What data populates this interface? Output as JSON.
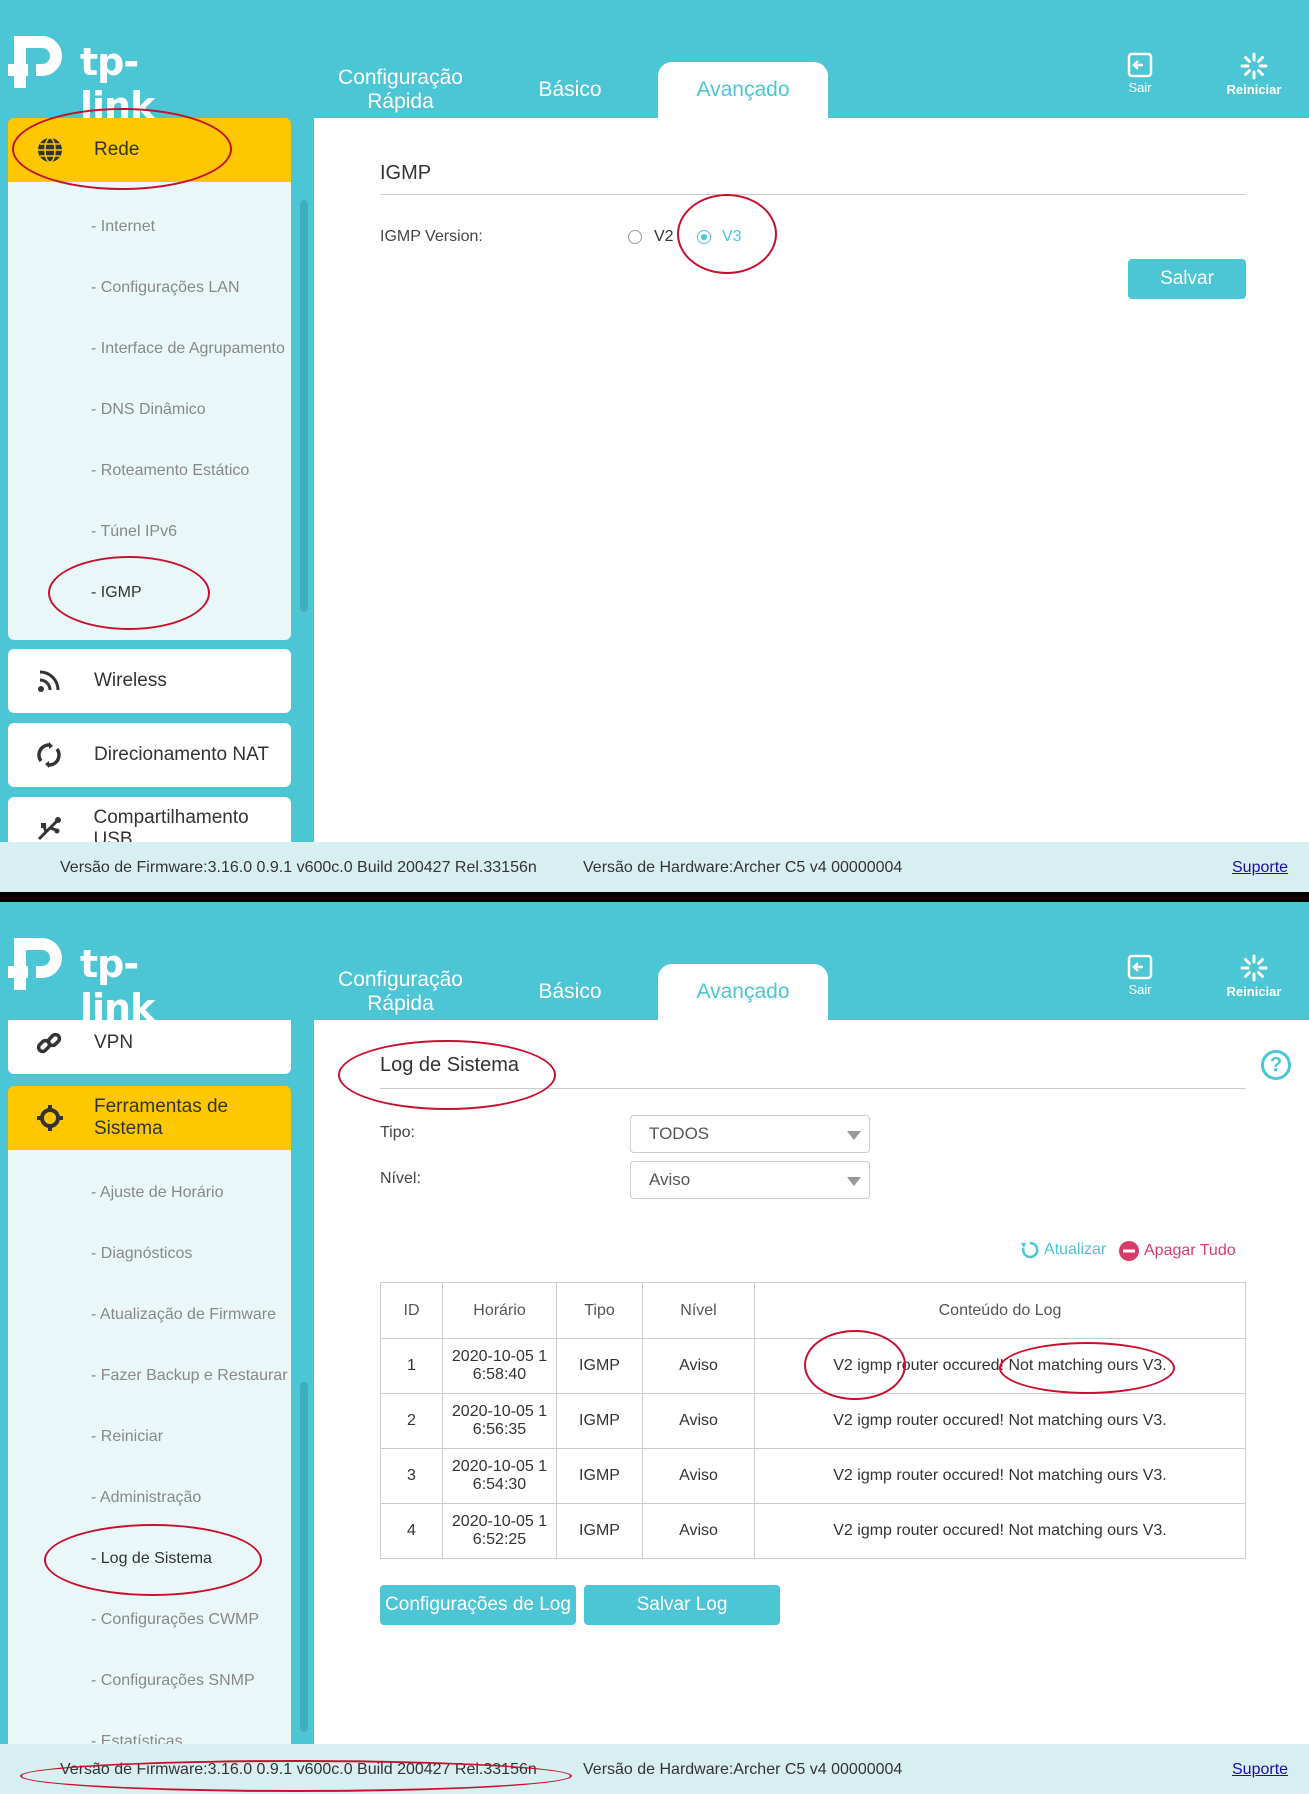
{
  "header": {
    "logo_text": "tp-link",
    "tabs": [
      {
        "label": "Configuração Rápida"
      },
      {
        "label": "Básico"
      },
      {
        "label": "Avançado"
      }
    ],
    "exit_label": "Sair",
    "reboot_label": "Reiniciar"
  },
  "panel1": {
    "sidebar": {
      "active_label": "Rede",
      "sub_items": [
        "- Internet",
        "- Configurações LAN",
        "- Interface de Agrupamento",
        "- DNS Dinâmico",
        "- Roteamento Estático",
        "- Túnel IPv6",
        "- IGMP"
      ],
      "other_items": [
        "Wireless",
        "Direcionamento NAT",
        "Compartilhamento USB"
      ]
    },
    "content": {
      "title": "IGMP",
      "version_label": "IGMP Version:",
      "options": [
        "V2",
        "V3"
      ],
      "selected": "V3",
      "save_label": "Salvar"
    }
  },
  "panel2": {
    "sidebar": {
      "top_item": "VPN",
      "active_label": "Ferramentas de Sistema",
      "sub_items": [
        "- Ajuste de Horário",
        "- Diagnósticos",
        "- Atualização de Firmware",
        "- Fazer Backup e Restaurar",
        "- Reiniciar",
        "- Administração",
        "- Log de Sistema",
        "- Configurações CWMP",
        "- Configurações SNMP",
        "- Estatísticas"
      ]
    },
    "content": {
      "title": "Log de Sistema",
      "type_label": "Tipo:",
      "type_value": "TODOS",
      "level_label": "Nível:",
      "level_value": "Aviso",
      "refresh_label": "Atualizar",
      "clear_label": "Apagar Tudo",
      "columns": [
        "ID",
        "Horário",
        "Tipo",
        "Nível",
        "Conteúdo do Log"
      ],
      "rows": [
        {
          "id": "1",
          "time": "2020-10-05 1 6:58:40",
          "type": "IGMP",
          "level": "Aviso",
          "content": "V2 igmp router occured! Not matching ours V3."
        },
        {
          "id": "2",
          "time": "2020-10-05 1 6:56:35",
          "type": "IGMP",
          "level": "Aviso",
          "content": "V2 igmp router occured! Not matching ours V3."
        },
        {
          "id": "3",
          "time": "2020-10-05 1 6:54:30",
          "type": "IGMP",
          "level": "Aviso",
          "content": "V2 igmp router occured! Not matching ours V3."
        },
        {
          "id": "4",
          "time": "2020-10-05 1 6:52:25",
          "type": "IGMP",
          "level": "Aviso",
          "content": "V2 igmp router occured! Not matching ours V3."
        }
      ],
      "log_settings_label": "Configurações de Log",
      "save_log_label": "Salvar Log"
    }
  },
  "footer": {
    "firmware": "Versão de Firmware:3.16.0 0.9.1 v600c.0 Build 200427 Rel.33156n",
    "hardware": "Versão de Hardware:Archer C5 v4 00000004",
    "support": "Suporte"
  },
  "colors": {
    "accent": "#4cc5d4",
    "active_menu": "#ffc700",
    "annotation": "#c8102e",
    "danger": "#d63c6b"
  }
}
